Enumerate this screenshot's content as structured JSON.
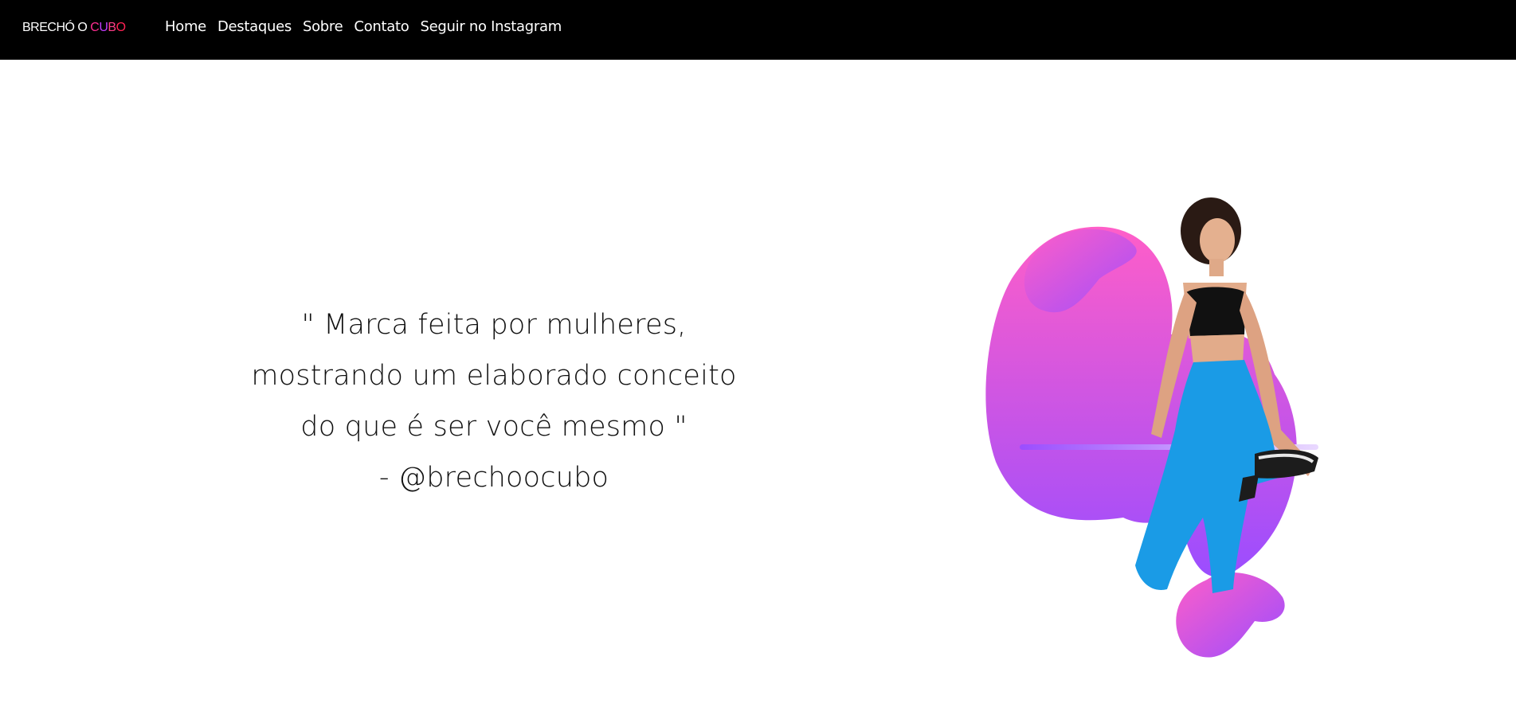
{
  "brand": {
    "prefix": "BRECHÓ O ",
    "letters": [
      {
        "char": "C",
        "color": "#ff2e93"
      },
      {
        "char": "U",
        "color": "#c13cff"
      },
      {
        "char": "B",
        "color": "#ff3f8a"
      },
      {
        "char": "O",
        "color": "#ff2255"
      }
    ]
  },
  "nav": {
    "items": [
      {
        "label": "Home"
      },
      {
        "label": "Destaques"
      },
      {
        "label": "Sobre"
      },
      {
        "label": "Contato"
      },
      {
        "label": "Seguir no Instagram"
      }
    ]
  },
  "hero": {
    "quote_lines": [
      "\" Marca feita por mulheres,",
      "mostrando um elaborado conceito",
      "do que é ser você mesmo \"",
      "- @brechoocubo"
    ],
    "image": {
      "icon": "woman-posing-illustration",
      "gradient_top": "#ff5ec8",
      "gradient_bottom": "#9b4dff",
      "pants_color": "#1a9be6",
      "top_color": "#111111"
    }
  }
}
